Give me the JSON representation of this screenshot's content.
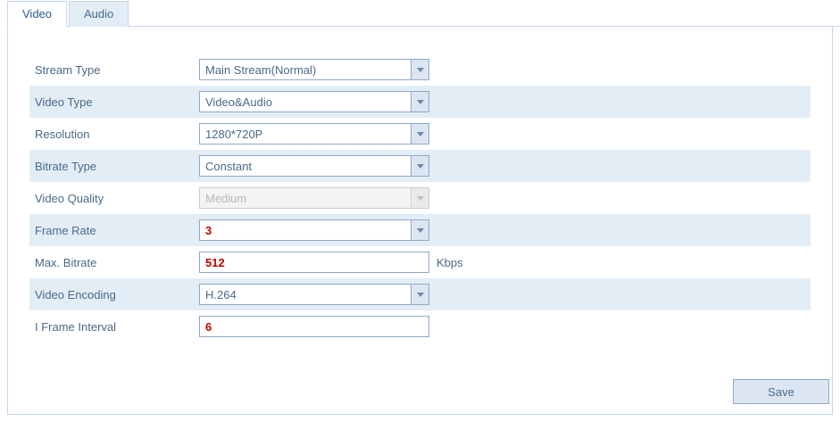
{
  "tabs": {
    "video": "Video",
    "audio": "Audio"
  },
  "fields": {
    "stream_type": {
      "label": "Stream Type",
      "value": "Main Stream(Normal)"
    },
    "video_type": {
      "label": "Video Type",
      "value": "Video&Audio"
    },
    "resolution": {
      "label": "Resolution",
      "value": "1280*720P"
    },
    "bitrate_type": {
      "label": "Bitrate Type",
      "value": "Constant"
    },
    "video_quality": {
      "label": "Video Quality",
      "value": "Medium"
    },
    "frame_rate": {
      "label": "Frame Rate",
      "value": "3"
    },
    "max_bitrate": {
      "label": "Max. Bitrate",
      "value": "512",
      "unit": "Kbps"
    },
    "video_encoding": {
      "label": "Video Encoding",
      "value": "H.264"
    },
    "iframe_interval": {
      "label": "I Frame Interval",
      "value": "6"
    }
  },
  "buttons": {
    "save": "Save"
  }
}
